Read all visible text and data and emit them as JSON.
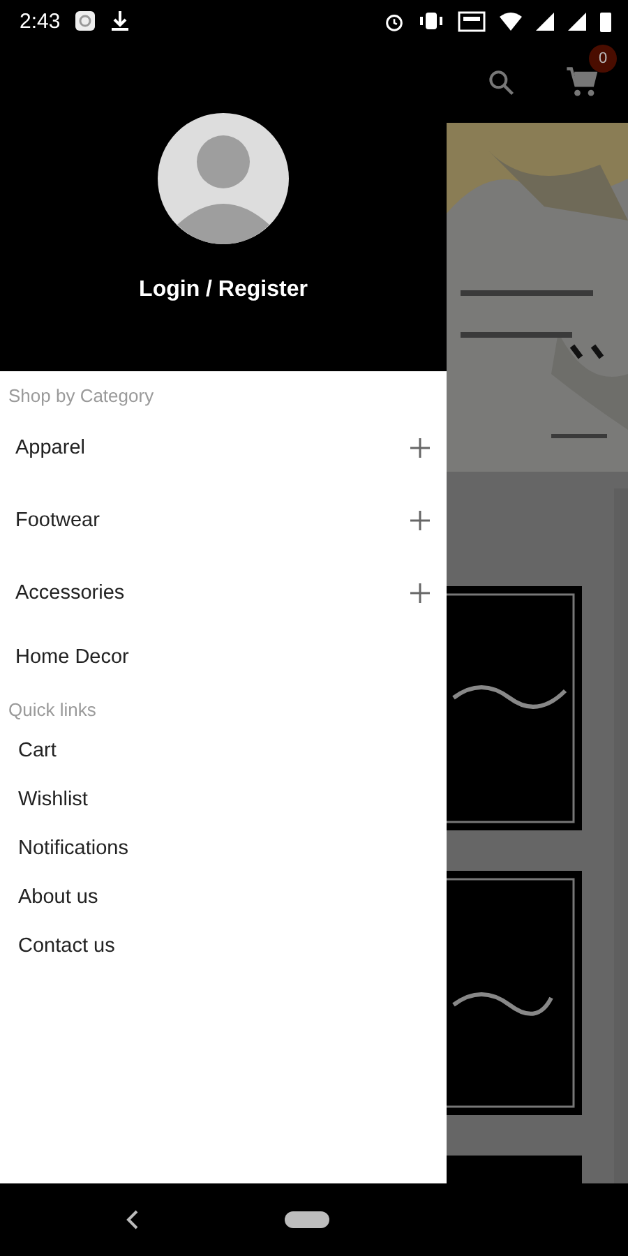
{
  "status_bar": {
    "time": "2:43"
  },
  "app_bar": {
    "cart_count": "0"
  },
  "drawer": {
    "login_label": "Login / Register",
    "sections": [
      {
        "title": "Shop by Category",
        "items": [
          {
            "label": "Apparel",
            "kind": "group",
            "expanded": false
          },
          {
            "label": "Footwear",
            "kind": "group",
            "expanded": false
          },
          {
            "label": "Accessories",
            "kind": "group",
            "expanded": false
          },
          {
            "label": "Home Decor",
            "kind": "link"
          }
        ]
      },
      {
        "title": "Quick links",
        "items": [
          {
            "label": "Cart",
            "kind": "quick"
          },
          {
            "label": "Wishlist",
            "kind": "quick"
          },
          {
            "label": "Notifications",
            "kind": "quick"
          },
          {
            "label": "About us",
            "kind": "quick"
          },
          {
            "label": "Contact us",
            "kind": "quick"
          }
        ]
      }
    ]
  }
}
